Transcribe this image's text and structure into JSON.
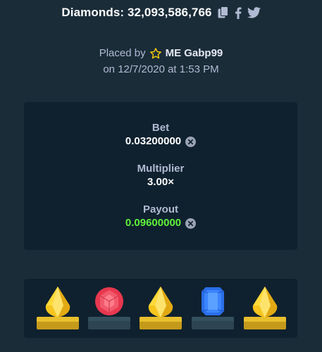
{
  "header": {
    "title": "Diamonds: 32,093,586,766",
    "icons": [
      "copy-icon",
      "facebook-icon",
      "twitter-icon"
    ]
  },
  "placed": {
    "prefix": "Placed by",
    "user_prefix": "ME",
    "username": "Gabp99",
    "date_line": "on 12/7/2020 at 1:53 PM"
  },
  "stats": {
    "bet_label": "Bet",
    "bet_value": "0.03200000",
    "multiplier_label": "Multiplier",
    "multiplier_value": "3.00×",
    "payout_label": "Payout",
    "payout_value": "0.09600000"
  },
  "tiles": [
    "yellow-gem",
    "red-gem",
    "yellow-gem",
    "blue-gem",
    "yellow-gem"
  ],
  "colors": {
    "background": "#1a2c38",
    "panel": "#0f212e",
    "payout_green": "#5ff23a",
    "gold": "#e8bf2d",
    "label_gray": "#b1bad3"
  }
}
